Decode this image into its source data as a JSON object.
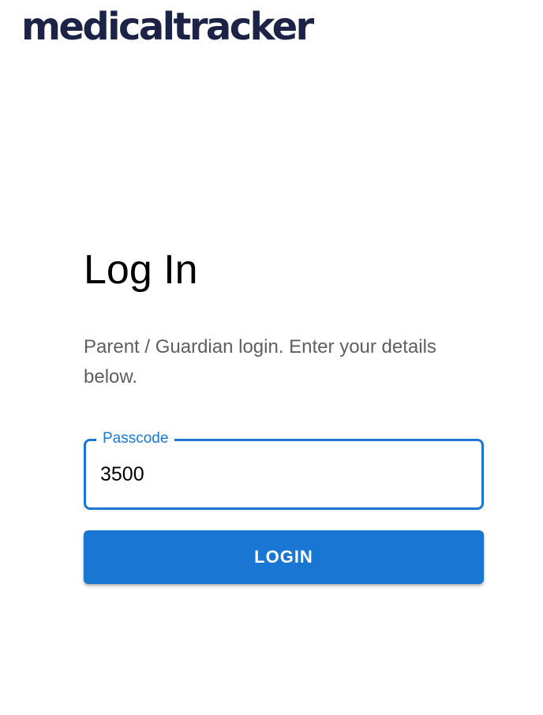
{
  "brand": {
    "logo_text": "medicaltracker",
    "color": "#1c2347"
  },
  "login": {
    "title": "Log In",
    "subtitle": "Parent / Guardian login. Enter your details below.",
    "passcode_label": "Passcode",
    "passcode_value": "3500",
    "button_label": "LOGIN"
  },
  "colors": {
    "accent": "#1976d2",
    "text_secondary": "#5f5f5f"
  }
}
